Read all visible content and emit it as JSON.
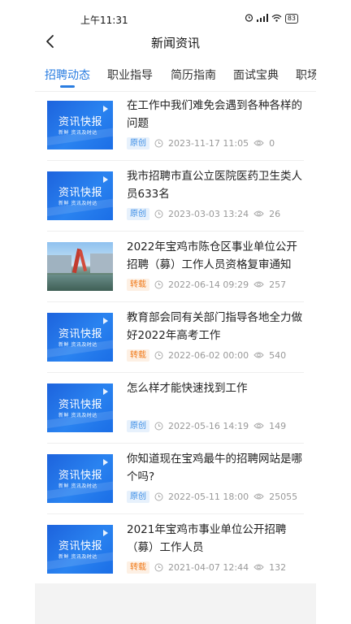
{
  "status_bar": {
    "time": "上午11:31",
    "battery": "83"
  },
  "header": {
    "title": "新闻资讯"
  },
  "tabs": [
    {
      "label": "招聘动态",
      "active": true
    },
    {
      "label": "职业指导",
      "active": false
    },
    {
      "label": "简历指南",
      "active": false
    },
    {
      "label": "面试宝典",
      "active": false
    },
    {
      "label": "职场",
      "active": false
    }
  ],
  "thumb_text": {
    "title": "资讯快报",
    "subtitle": "新鲜 资讯及时达"
  },
  "articles": [
    {
      "title": "在工作中我们难免会遇到各种各样的问题",
      "tag": "原创",
      "date": "2023-11-17 11:05",
      "views": "0"
    },
    {
      "title": "我市招聘市直公立医院医药卫生类人员633名",
      "tag": "原创",
      "date": "2023-03-03 13:24",
      "views": "26"
    },
    {
      "title": "2022年宝鸡市陈仓区事业单位公开招聘（募）工作人员资格复审通知",
      "tag": "转载",
      "date": "2022-06-14 09:29",
      "views": "257"
    },
    {
      "title": "教育部会同有关部门指导各地全力做好2022年高考工作",
      "tag": "转载",
      "date": "2022-06-02 00:00",
      "views": "540"
    },
    {
      "title": "怎么样才能快速找到工作",
      "tag": "原创",
      "date": "2022-05-16 14:19",
      "views": "149"
    },
    {
      "title": "你知道现在宝鸡最牛的招聘网站是哪个吗?",
      "tag": "原创",
      "date": "2022-05-11 18:00",
      "views": "25055"
    },
    {
      "title": "2021年宝鸡市事业单位公开招聘（募）工作人员",
      "tag": "转载",
      "date": "2021-04-07 12:44",
      "views": "132"
    }
  ],
  "colors": {
    "accent": "#2a7de1",
    "tag_original": "#3b8de6",
    "tag_repost": "#f07a1a"
  }
}
